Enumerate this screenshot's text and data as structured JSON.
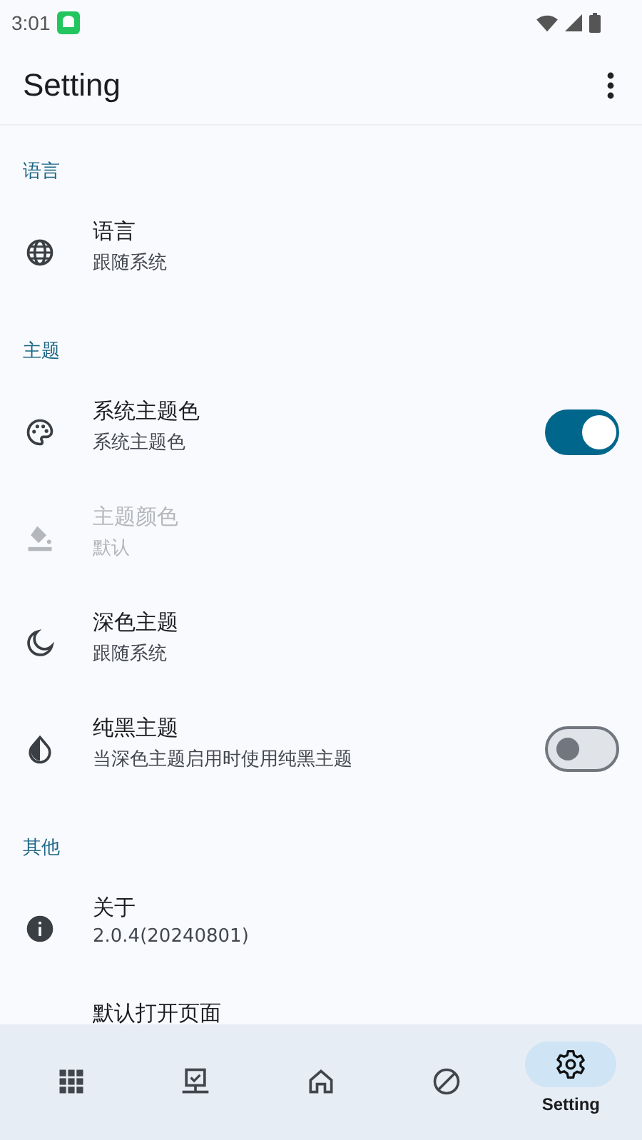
{
  "status_bar": {
    "time": "3:01"
  },
  "app_bar": {
    "title": "Setting"
  },
  "sections": [
    {
      "header": "语言",
      "items": [
        {
          "title": "语言",
          "subtitle": "跟随系统",
          "disabled": false
        }
      ]
    },
    {
      "header": "主题",
      "items": [
        {
          "title": "系统主题色",
          "subtitle": "系统主题色",
          "disabled": false,
          "kind": "switch",
          "on": true
        },
        {
          "title": "主题颜色",
          "subtitle": "默认",
          "disabled": true
        },
        {
          "title": "深色主题",
          "subtitle": "跟随系统",
          "disabled": false
        },
        {
          "title": "纯黑主题",
          "subtitle": "当深色主题启用时使用纯黑主题",
          "disabled": false,
          "kind": "switch",
          "on": false
        }
      ]
    },
    {
      "header": "其他",
      "items": [
        {
          "title": "关于",
          "subtitle": "2.0.4(20240801)",
          "disabled": false
        },
        {
          "title": "默认打开页面",
          "disabled": false
        }
      ]
    }
  ],
  "nav": [
    {
      "selected": false
    },
    {
      "selected": false
    },
    {
      "selected": false
    },
    {
      "selected": false
    },
    {
      "label": "Setting",
      "selected": true
    }
  ]
}
